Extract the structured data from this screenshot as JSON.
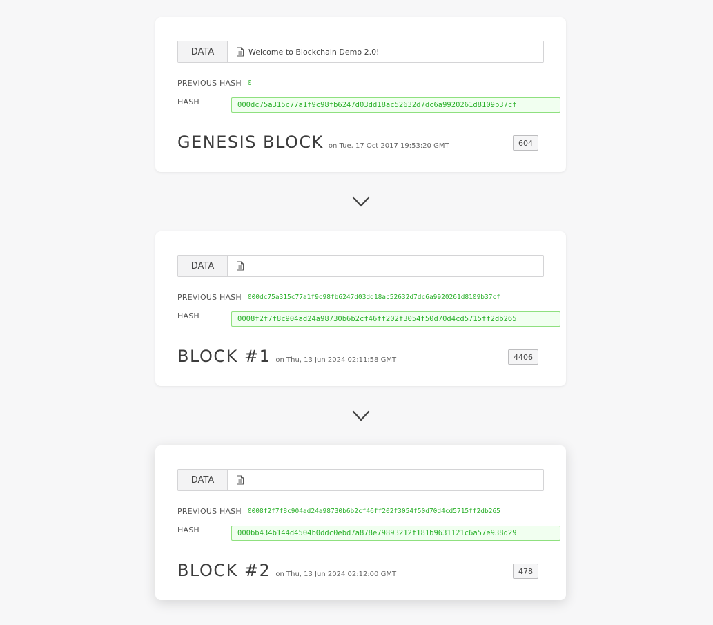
{
  "blocks": [
    {
      "data_label": "DATA",
      "data_value": "Welcome to Blockchain Demo 2.0!",
      "prev_hash_label": "PREVIOUS HASH",
      "prev_hash": "0",
      "hash_label": "HASH",
      "hash": "000dc75a315c77a1f9c98fb6247d03dd18ac52632d7dc6a9920261d8109b37cf",
      "title": "GENESIS BLOCK",
      "timestamp": "on Tue, 17 Oct 2017 19:53:20 GMT",
      "nonce": "604"
    },
    {
      "data_label": "DATA",
      "data_value": "",
      "prev_hash_label": "PREVIOUS HASH",
      "prev_hash": "000dc75a315c77a1f9c98fb6247d03dd18ac52632d7dc6a9920261d8109b37cf",
      "hash_label": "HASH",
      "hash": "0008f2f7f8c904ad24a98730b6b2cf46ff202f3054f50d70d4cd5715ff2db265",
      "title": "BLOCK #1",
      "timestamp": "on Thu, 13 Jun 2024 02:11:58 GMT",
      "nonce": "4406"
    },
    {
      "data_label": "DATA",
      "data_value": "",
      "prev_hash_label": "PREVIOUS HASH",
      "prev_hash": "0008f2f7f8c904ad24a98730b6b2cf46ff202f3054f50d70d4cd5715ff2db265",
      "hash_label": "HASH",
      "hash": "000bb434b144d4504b0ddc0ebd7a878e79893212f181b9631121c6a57e938d29",
      "title": "BLOCK #2",
      "timestamp": "on Thu, 13 Jun 2024 02:12:00 GMT",
      "nonce": "478"
    }
  ],
  "colors": {
    "hash_green": "#2bb02b",
    "hash_border": "#8fe07f",
    "hash_bg": "#f1fff0",
    "page_bg": "#f7f7f8"
  },
  "icons": {
    "data_field": "document-icon",
    "connector": "chevron-down-icon"
  }
}
